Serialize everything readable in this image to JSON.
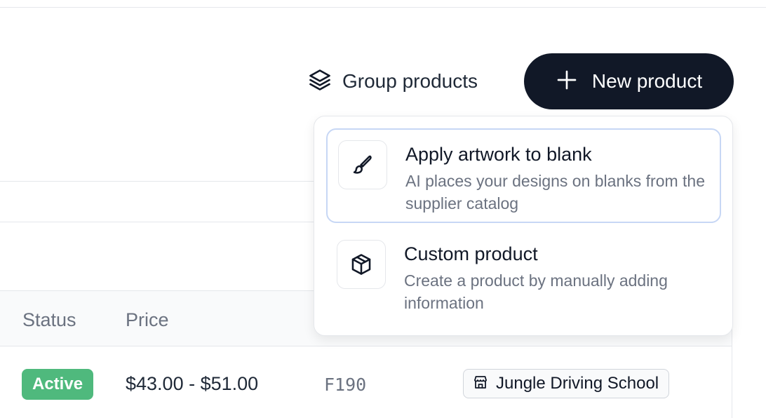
{
  "toolbar": {
    "group_label": "Group products",
    "group_icon": "layers-icon",
    "new_label": "New product",
    "new_icon": "plus-icon"
  },
  "dropdown": {
    "options": [
      {
        "title": "Apply artwork to blank",
        "description": "AI places your designs on blanks from the supplier catalog",
        "icon": "paintbrush-icon"
      },
      {
        "title": "Custom product",
        "description": "Create a product by manually adding information",
        "icon": "package-icon"
      }
    ]
  },
  "table": {
    "headers": [
      "Status",
      "Price"
    ],
    "rows": [
      {
        "status": "Active",
        "price": "$43.00 - $51.00",
        "sku": "F190",
        "store": "Jungle Driving School",
        "store_icon": "store-icon"
      }
    ]
  },
  "colors": {
    "primary_button": "#111827",
    "active_badge": "#4fb97d",
    "highlight_border": "#c7d7f5"
  }
}
